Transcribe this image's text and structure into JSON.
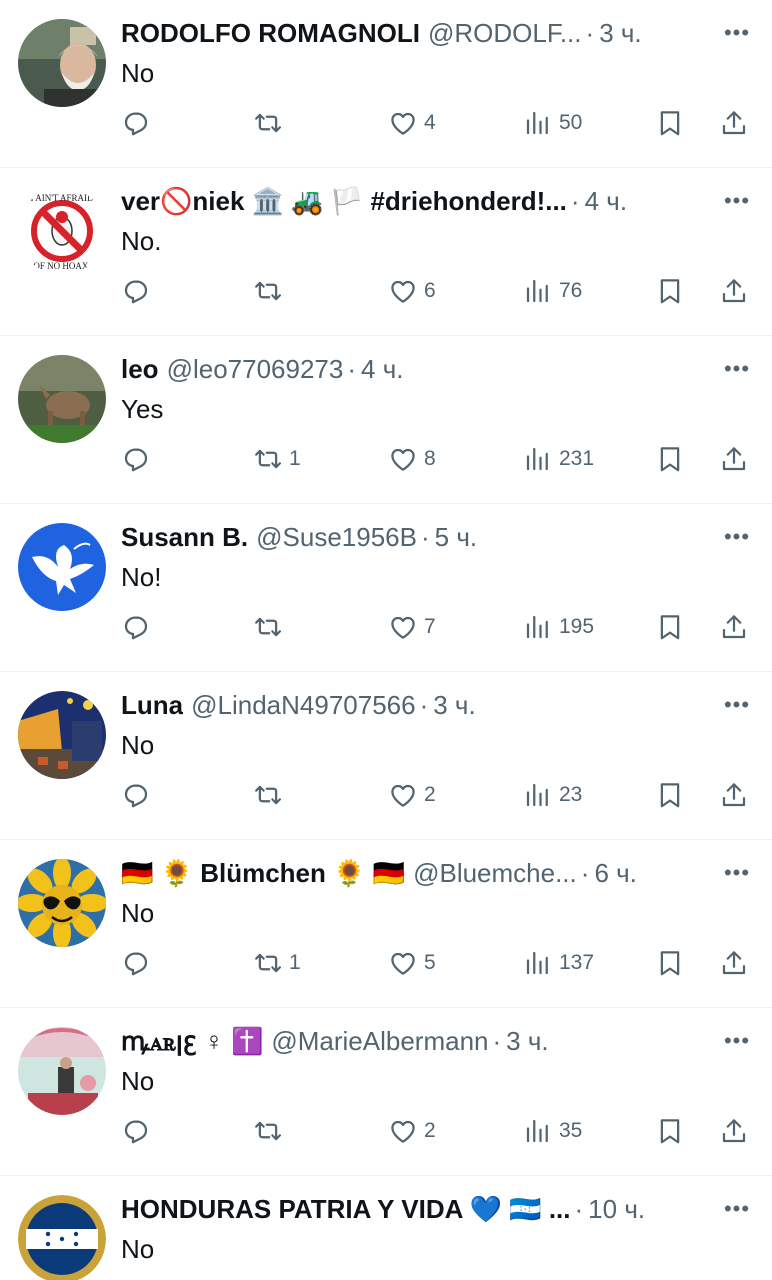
{
  "icons": {
    "reply": "reply-icon",
    "retweet": "retweet-icon",
    "like": "heart-icon",
    "views": "views-bar-chart-icon",
    "bookmark": "bookmark-icon",
    "share": "share-upload-icon",
    "more": "more-dots-icon"
  },
  "colors": {
    "text": "#0f1419",
    "muted": "#536471",
    "divider": "#eff3f4"
  },
  "replies": [
    {
      "name": "RODOLFO ROMAGNOLI",
      "handle": "@RODOLF...",
      "time": "3 ч.",
      "text": "No",
      "retweets": "",
      "likes": "4",
      "views": "50"
    },
    {
      "name": "ver🚫niek 🏛️ 🚜 🏳️ #driehonderd!...",
      "handle": "",
      "time": "4 ч.",
      "text": "No.",
      "retweets": "",
      "likes": "6",
      "views": "76"
    },
    {
      "name": "leo",
      "handle": "@leo77069273",
      "time": "4 ч.",
      "text": "Yes",
      "retweets": "1",
      "likes": "8",
      "views": "231"
    },
    {
      "name": "Susann B.",
      "handle": "@Suse1956B",
      "time": "5 ч.",
      "text": "No!",
      "retweets": "",
      "likes": "7",
      "views": "195"
    },
    {
      "name": "Luna",
      "handle": "@LindaN49707566",
      "time": "3 ч.",
      "text": "No",
      "retweets": "",
      "likes": "2",
      "views": "23"
    },
    {
      "name": "🇩🇪 🌻 Blümchen 🌻 🇩🇪",
      "handle": "@Bluemche...",
      "time": "6 ч.",
      "text": "No",
      "retweets": "1",
      "likes": "5",
      "views": "137"
    },
    {
      "name": "ꝳꭺꭱꞁꜫ ♀ ✝️",
      "handle": "@MarieAlbermann",
      "time": "3 ч.",
      "text": "No",
      "retweets": "",
      "likes": "2",
      "views": "35"
    },
    {
      "name": "HONDURAS PATRIA Y VIDA 💙 🇭🇳 ...",
      "handle": "",
      "time": "10 ч.",
      "text": "No",
      "retweets": "",
      "likes": "",
      "views": ""
    }
  ]
}
